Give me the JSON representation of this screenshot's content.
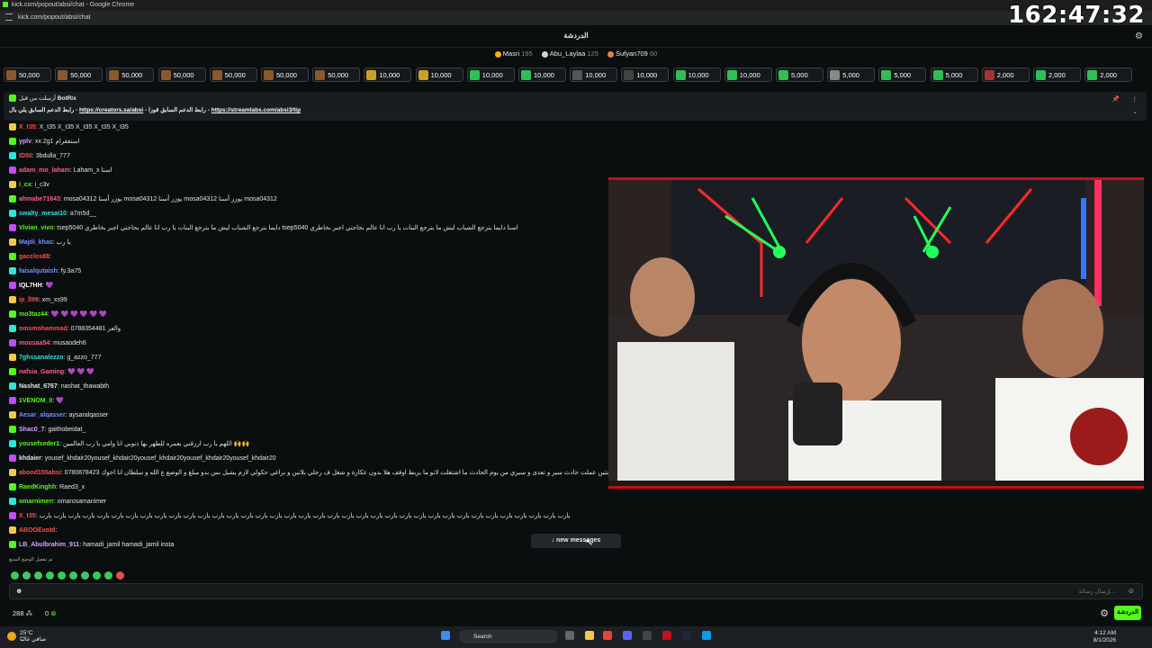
{
  "window": {
    "title": "kick.com/popout/absi/chat - Google Chrome",
    "url": "kick.com/popout/absi/chat"
  },
  "overlay_timer": "162:47:32",
  "chat_header": {
    "title": "الدردشة"
  },
  "leaderboard": [
    {
      "name": "Masri",
      "points": "195",
      "color": "#f2b01e"
    },
    {
      "name": "Abu_Laylaa",
      "points": "125",
      "color": "#cfd3d6"
    },
    {
      "name": "Sufyan709",
      "points": "60",
      "color": "#d8884a"
    }
  ],
  "gifts": [
    {
      "value": "50,000",
      "color": "#8a5a2c"
    },
    {
      "value": "50,000",
      "color": "#8a5a2c"
    },
    {
      "value": "50,000",
      "color": "#8a5a2c"
    },
    {
      "value": "50,000",
      "color": "#8a5a2c"
    },
    {
      "value": "50,000",
      "color": "#8a5a2c"
    },
    {
      "value": "50,000",
      "color": "#8a5a2c"
    },
    {
      "value": "50,000",
      "color": "#8a5a2c"
    },
    {
      "value": "10,000",
      "color": "#c9a227"
    },
    {
      "value": "10,000",
      "color": "#c9a227"
    },
    {
      "value": "10,000",
      "color": "#2fbf55"
    },
    {
      "value": "10,000",
      "color": "#2fbf55"
    },
    {
      "value": "10,000",
      "color": "#555"
    },
    {
      "value": "10,000",
      "color": "#444"
    },
    {
      "value": "10,000",
      "color": "#2fbf55"
    },
    {
      "value": "10,000",
      "color": "#2fbf55"
    },
    {
      "value": "5,000",
      "color": "#2fbf55"
    },
    {
      "value": "5,000",
      "color": "#888"
    },
    {
      "value": "5,000",
      "color": "#2fbf55"
    },
    {
      "value": "5,000",
      "color": "#2fbf55"
    },
    {
      "value": "2,000",
      "color": "#a83232"
    },
    {
      "value": "2,000",
      "color": "#2fbf55"
    },
    {
      "value": "2,000",
      "color": "#2fbf55"
    }
  ],
  "pinned": {
    "author_prefix": "أرسلت من قبل",
    "author": "BotRix",
    "text_a": "رابط الدعم السابق يلي بال - ",
    "link_a": "https://creators.sa/absi",
    "text_b": " - رابط الدعم السابق قوزا - ",
    "link_b": "https://streamlabs.com/absi3/tip"
  },
  "messages": [
    {
      "user": "X_t35",
      "color": "#ff4d4d",
      "text": "X_t35 X_t35 X_t35 X_t35 X_t35"
    },
    {
      "user": "yplv",
      "color": "#d6a3ff",
      "text": "xx.2g1 استغفرام"
    },
    {
      "user": "ID50",
      "color": "#ff4d4d",
      "text": "3bdulla_777"
    },
    {
      "user": "adam_mo_laham",
      "color": "#ff5c8a",
      "text": "Laham_x اسنا"
    },
    {
      "user": "i_cx",
      "color": "#53fc18",
      "text": "i_c3v"
    },
    {
      "user": "ahmabe71643",
      "color": "#ff5c8a",
      "text": "mosa04312 يوزر أسنا mosa04312 يوزر أسنا mosa04312 يوزر أسنا mosa04312"
    },
    {
      "user": "swalty_mesai10",
      "color": "#2ee6d6",
      "text": "a7m5d__"
    },
    {
      "user": "Vivian_vivo",
      "color": "#53fc18",
      "text": "tsep5040 دايما بترجع الشباب ليش ما بترجع البنات يا رب انا عالم بحاجتي اجبر بخاطري tsep5040 اسنا دايما بترجع الشباب ليش ما بترجع البنات يا رب انا عالم بحاجتي اجبر بخاطري"
    },
    {
      "user": "Majdi_khas",
      "color": "#7c8cff",
      "text": "يا رب"
    },
    {
      "user": "gacclos88",
      "color": "#ff4d4d",
      "text": ""
    },
    {
      "user": "faisalqutaish",
      "color": "#7c8cff",
      "text": "fy.3a75"
    },
    {
      "user": "IQL7HH",
      "color": "#ffffff",
      "text": "💜"
    },
    {
      "user": "ip_ll99",
      "color": "#ff4d4d",
      "text": "xm_xs99"
    },
    {
      "user": "mo3taz44",
      "color": "#53fc18",
      "text": "💜 💜 💜 💜 💜 💜"
    },
    {
      "user": "omsmohammad",
      "color": "#ff4d4d",
      "text": "0788354481 والعر"
    },
    {
      "user": "mousaa54",
      "color": "#ff5c8a",
      "text": "musaodeh6"
    },
    {
      "user": "7ghssanalezzo",
      "color": "#2ee6d6",
      "text": "g_azzo_777"
    },
    {
      "user": "nafsia_Gaming",
      "color": "#ff5c8a",
      "text": "💜 💜 💜"
    },
    {
      "user": "Nashat_6767",
      "color": "#e5e5e5",
      "text": "nashat_thawabth"
    },
    {
      "user": "1VENOM_0",
      "color": "#53fc18",
      "text": "💜"
    },
    {
      "user": "Aesar_alqasser",
      "color": "#7c8cff",
      "text": "aysaralqasser"
    },
    {
      "user": "Shac0_7",
      "color": "#d6a3ff",
      "text": "gaithobeidat_"
    },
    {
      "user": "yousefseder1",
      "color": "#53fc18",
      "text": "اللهم يا رب ارزقني بعمره للطهر بها ذنوبي انا وامي يا رب العالمين 🙌🙌"
    },
    {
      "user": "khdaier",
      "color": "#e5e5e5",
      "text": "yousef_khdair20yousef_khdair20yousef_khdair20yousef_khdair20yousef_khdair20"
    },
    {
      "user": "abood155absi",
      "color": "#ff4d4d",
      "text": "0780878423 يا خوية اشرف من عمان قبل سنتين عملت حادث سير و تعدى و سيري من يوم الحادث ما اشتغلت لانو ما بزبط اوقف هلا بدون عكازة و شغل ف رجلي بلاتين و براغي حكولي لازم يشيل بس بدو مبلغ و الوضع ع الله و سلطان انا اخوك"
    },
    {
      "user": "RaedKinghh",
      "color": "#53fc18",
      "text": "Raed3_x"
    },
    {
      "user": "omarnimerr",
      "color": "#53fc18",
      "text": "omarosamanimer"
    },
    {
      "user": "X_t35",
      "color": "#ff4d4d",
      "text": "يارب يارب يارب يارب يارب يارب يارب يارب يارب يارب يارب يارب يارب يارب يارب يارب يارب يارب يارب يارب يارب يارب يارب يارب يارب يارب يارب يارب يارب يارب يارب يارب يارب يارب يارب يارب يارب"
    },
    {
      "user": "ABOOExotd",
      "color": "#ff4d4d",
      "text": ""
    },
    {
      "user": "LB_Abulbrahim_911",
      "color": "#d6a3ff",
      "text": "hamadi_jamil hamadi_jamil insta"
    }
  ],
  "new_messages": "↓ new messages",
  "emote_note": "تم تفعيل الوضع المتبع",
  "input": {
    "placeholder": "إرسال رسالة..."
  },
  "footer": {
    "viewers": "288",
    "kicks": "0",
    "chat_button": "الدردشة"
  },
  "taskbar": {
    "temp": "25°C",
    "weather": "صافي غالبًا",
    "search": "Search",
    "time": "4:12 AM",
    "date": "8/1/2026"
  }
}
